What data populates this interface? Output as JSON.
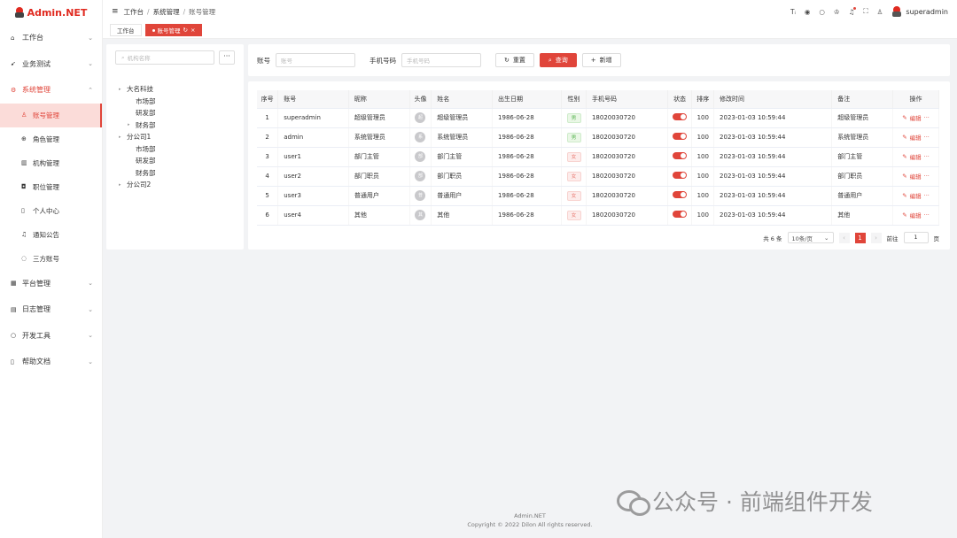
{
  "app": {
    "title": "Admin.NET"
  },
  "sidebar": {
    "items": [
      {
        "label": "工作台",
        "icon": "home-icon",
        "glyph": "⌂"
      },
      {
        "label": "业务测试",
        "icon": "send-icon",
        "glyph": "➹"
      },
      {
        "label": "系统管理",
        "icon": "gear-icon",
        "glyph": "⚙"
      }
    ],
    "sub_items": [
      {
        "label": "账号管理",
        "icon": "user-icon",
        "glyph": "♙"
      },
      {
        "label": "角色管理",
        "icon": "role-icon",
        "glyph": "⊕"
      },
      {
        "label": "机构管理",
        "icon": "org-icon",
        "glyph": "▥"
      },
      {
        "label": "职位管理",
        "icon": "position-icon",
        "glyph": "◘"
      },
      {
        "label": "个人中心",
        "icon": "profile-icon",
        "glyph": "▯"
      },
      {
        "label": "通知公告",
        "icon": "bell-icon",
        "glyph": "♫"
      },
      {
        "label": "三方账号",
        "icon": "chat-icon",
        "glyph": "◌"
      }
    ],
    "bottom_items": [
      {
        "label": "平台管理",
        "icon": "grid-icon",
        "glyph": "▦"
      },
      {
        "label": "日志管理",
        "icon": "log-icon",
        "glyph": "▤"
      },
      {
        "label": "开发工具",
        "icon": "tool-icon",
        "glyph": "○"
      },
      {
        "label": "帮助文档",
        "icon": "doc-icon",
        "glyph": "▯"
      }
    ]
  },
  "header": {
    "breadcrumb": [
      "工作台",
      "系统管理",
      "账号管理"
    ],
    "username": "superadmin"
  },
  "tabs": [
    {
      "label": "工作台"
    },
    {
      "label": "账号管理"
    }
  ],
  "org_tree": {
    "search_placeholder": "机构名称",
    "more_label": "···",
    "nodes": [
      {
        "label": "大名科技",
        "level": 1,
        "arrow": true
      },
      {
        "label": "市场部",
        "level": 2,
        "arrow": false
      },
      {
        "label": "研发部",
        "level": 2,
        "arrow": false
      },
      {
        "label": "财务部",
        "level": 2,
        "arrow": true
      },
      {
        "label": "分公司1",
        "level": 1,
        "arrow": true
      },
      {
        "label": "市场部",
        "level": 2,
        "arrow": false
      },
      {
        "label": "研发部",
        "level": 2,
        "arrow": false
      },
      {
        "label": "财务部",
        "level": 2,
        "arrow": false
      },
      {
        "label": "分公司2",
        "level": 1,
        "arrow": true
      }
    ]
  },
  "search": {
    "account_label": "账号",
    "account_placeholder": "账号",
    "phone_label": "手机号码",
    "phone_placeholder": "手机号码",
    "reset_label": "重置",
    "query_label": "查询",
    "add_label": "新增"
  },
  "table": {
    "columns": [
      "序号",
      "账号",
      "昵称",
      "头像",
      "姓名",
      "出生日期",
      "性别",
      "手机号码",
      "状态",
      "排序",
      "修改时间",
      "备注",
      "操作"
    ],
    "rows": [
      {
        "index": "1",
        "account": "superadmin",
        "nickname": "超级管理员",
        "avatar": "超",
        "name": "超级管理员",
        "birth": "1986-06-28",
        "sex": "男",
        "sex_type": "male",
        "phone": "18020030720",
        "status": true,
        "order": "100",
        "modified": "2023-01-03 10:59:44",
        "remark": "超级管理员"
      },
      {
        "index": "2",
        "account": "admin",
        "nickname": "系统管理员",
        "avatar": "系",
        "name": "系统管理员",
        "birth": "1986-06-28",
        "sex": "男",
        "sex_type": "male",
        "phone": "18020030720",
        "status": true,
        "order": "100",
        "modified": "2023-01-03 10:59:44",
        "remark": "系统管理员"
      },
      {
        "index": "3",
        "account": "user1",
        "nickname": "部门主管",
        "avatar": "部",
        "name": "部门主管",
        "birth": "1986-06-28",
        "sex": "女",
        "sex_type": "female",
        "phone": "18020030720",
        "status": true,
        "order": "100",
        "modified": "2023-01-03 10:59:44",
        "remark": "部门主管"
      },
      {
        "index": "4",
        "account": "user2",
        "nickname": "部门职员",
        "avatar": "部",
        "name": "部门职员",
        "birth": "1986-06-28",
        "sex": "女",
        "sex_type": "female",
        "phone": "18020030720",
        "status": true,
        "order": "100",
        "modified": "2023-01-03 10:59:44",
        "remark": "部门职员"
      },
      {
        "index": "5",
        "account": "user3",
        "nickname": "普通用户",
        "avatar": "普",
        "name": "普通用户",
        "birth": "1986-06-28",
        "sex": "女",
        "sex_type": "female",
        "phone": "18020030720",
        "status": true,
        "order": "100",
        "modified": "2023-01-03 10:59:44",
        "remark": "普通用户"
      },
      {
        "index": "6",
        "account": "user4",
        "nickname": "其他",
        "avatar": "其",
        "name": "其他",
        "birth": "1986-06-28",
        "sex": "女",
        "sex_type": "female",
        "phone": "18020030720",
        "status": true,
        "order": "100",
        "modified": "2023-01-03 10:59:44",
        "remark": "其他"
      }
    ],
    "edit_label": "编辑",
    "more_label": "···"
  },
  "pagination": {
    "total_text": "共 6 条",
    "page_size": "10条/页",
    "current_page": "1",
    "goto_label": "前往",
    "goto_value": "1",
    "page_unit": "页"
  },
  "footer": {
    "line1": "Admin.NET",
    "line2": "Copyright © 2022 Dilon All rights reserved."
  },
  "watermark": {
    "text": "公众号 · 前端组件开发"
  },
  "colors": {
    "accent": "#e0453a",
    "brand": "#e02a20"
  }
}
